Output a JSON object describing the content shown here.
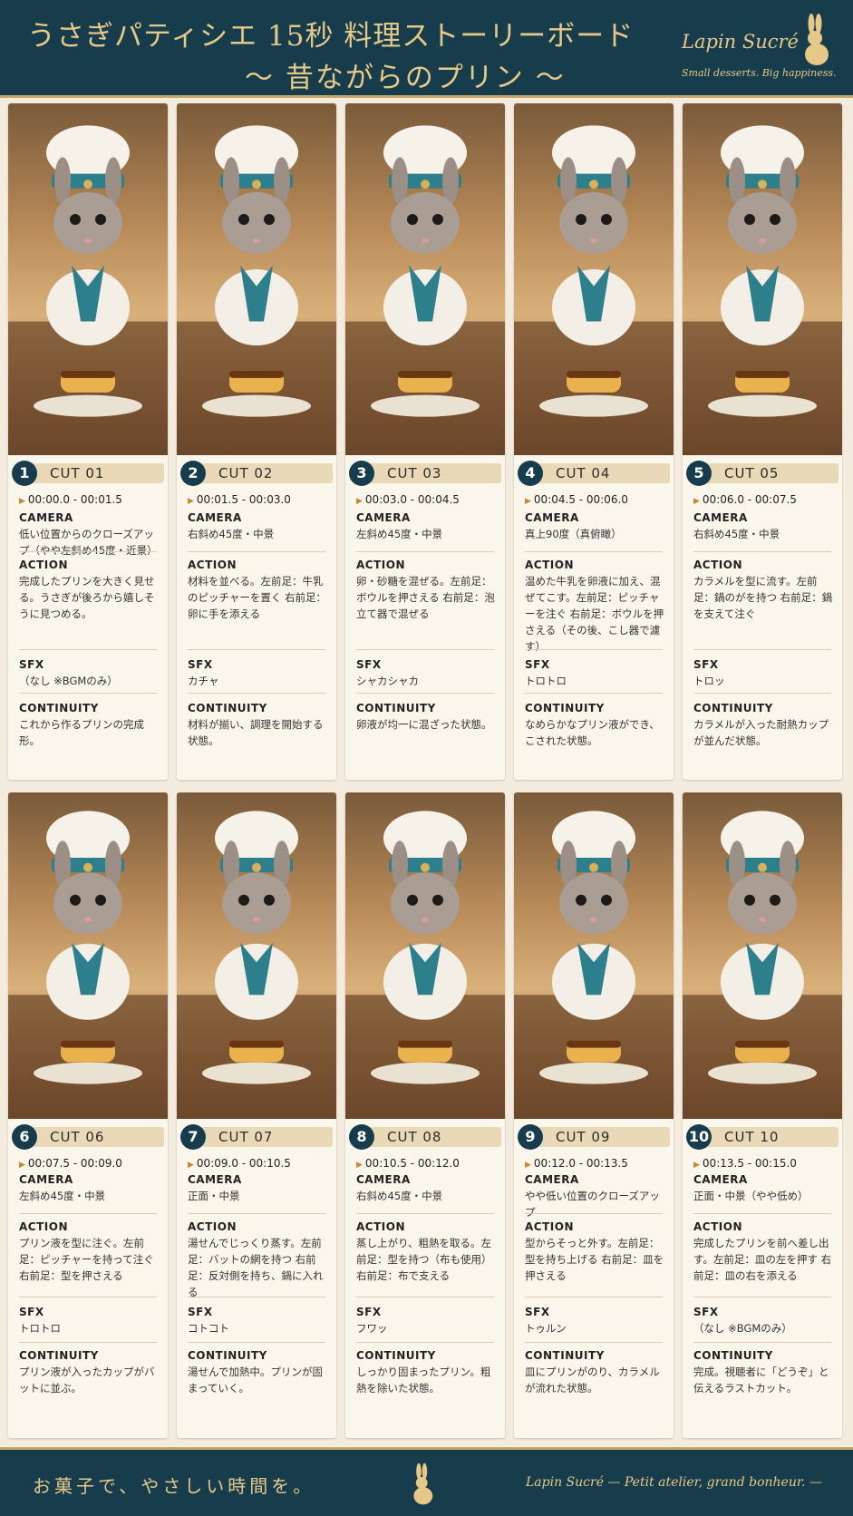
{
  "header": {
    "title_line1": "うさぎパティシエ 15秒 料理ストーリーボード",
    "title_line2": "〜 昔ながらのプリン 〜",
    "brand": "Lapin Sucré",
    "tagline": "Small desserts. Big happiness."
  },
  "labels": {
    "camera": "CAMERA",
    "action": "ACTION",
    "sfx": "SFX",
    "continuity": "CONTINUITY"
  },
  "cuts": [
    {
      "num": "1",
      "cut": "CUT 01",
      "time": "00:00.0 - 00:01.5",
      "camera": "低い位置からのクローズアップ（やや左斜め45度・近景）",
      "action": "完成したプリンを大きく見せる。うさぎが後ろから嬉しそうに見つめる。",
      "sfx": "（なし ※BGMのみ）",
      "continuity": "これから作るプリンの完成形。"
    },
    {
      "num": "2",
      "cut": "CUT 02",
      "time": "00:01.5 - 00:03.0",
      "camera": "右斜め45度・中景",
      "action": "材料を並べる。左前足：牛乳のピッチャーを置く 右前足：卵に手を添える",
      "sfx": "カチャ",
      "continuity": "材料が揃い、調理を開始する状態。"
    },
    {
      "num": "3",
      "cut": "CUT 03",
      "time": "00:03.0 - 00:04.5",
      "camera": "左斜め45度・中景",
      "action": "卵・砂糖を混ぜる。左前足：ボウルを押さえる 右前足：泡立て器で混ぜる",
      "sfx": "シャカシャカ",
      "continuity": "卵液が均一に混ざった状態。"
    },
    {
      "num": "4",
      "cut": "CUT 04",
      "time": "00:04.5 - 00:06.0",
      "camera": "真上90度（真俯瞰）",
      "action": "温めた牛乳を卵液に加え、混ぜてこす。左前足：ピッチャーを注ぐ 右前足：ボウルを押さえる（その後、こし器で濾す）",
      "sfx": "トロトロ",
      "continuity": "なめらかなプリン液ができ、こされた状態。"
    },
    {
      "num": "5",
      "cut": "CUT 05",
      "time": "00:06.0 - 00:07.5",
      "camera": "右斜め45度・中景",
      "action": "カラメルを型に流す。左前足：鍋のがを持つ 右前足：鍋を支えて注ぐ",
      "sfx": "トロッ",
      "continuity": "カラメルが入った耐熱カップが並んだ状態。"
    },
    {
      "num": "6",
      "cut": "CUT 06",
      "time": "00:07.5 - 00:09.0",
      "camera": "左斜め45度・中景",
      "action": "プリン液を型に注ぐ。左前足：ピッチャーを持って注ぐ 右前足：型を押さえる",
      "sfx": "トロトロ",
      "continuity": "プリン液が入ったカップがバットに並ぶ。"
    },
    {
      "num": "7",
      "cut": "CUT 07",
      "time": "00:09.0 - 00:10.5",
      "camera": "正面・中景",
      "action": "湯せんでじっくり蒸す。左前足：バットの網を持つ 右前足：反対側を持ち、鍋に入れる",
      "sfx": "コトコト",
      "continuity": "湯せんで加熱中。プリンが固まっていく。"
    },
    {
      "num": "8",
      "cut": "CUT 08",
      "time": "00:10.5 - 00:12.0",
      "camera": "右斜め45度・中景",
      "action": "蒸し上がり、粗熱を取る。左前足：型を持つ（布も使用） 右前足：布で支える",
      "sfx": "フワッ",
      "continuity": "しっかり固まったプリン。粗熱を除いた状態。"
    },
    {
      "num": "9",
      "cut": "CUT 09",
      "time": "00:12.0 - 00:13.5",
      "camera": "やや低い位置のクローズアップ",
      "action": "型からそっと外す。左前足：型を持ち上げる 右前足：皿を押さえる",
      "sfx": "トゥルン",
      "continuity": "皿にプリンがのり、カラメルが流れた状態。"
    },
    {
      "num": "10",
      "cut": "CUT 10",
      "time": "00:13.5 - 00:15.0",
      "camera": "正面・中景（やや低め）",
      "action": "完成したプリンを前へ差し出す。左前足：皿の左を押す 右前足：皿の右を添える",
      "sfx": "（なし ※BGMのみ）",
      "continuity": "完成。視聴者に「どうぞ」と伝えるラストカット。"
    }
  ],
  "footer": {
    "left": "お菓子で、やさしい時間を。",
    "right": "Lapin Sucré — Petit atelier, grand bonheur. —"
  },
  "colors": {
    "navy": "#173d4d",
    "gold": "#e6c888",
    "cream": "#fbf6ec",
    "accent": "#c8892e"
  },
  "icons": [
    "rabbit-logo-icon",
    "chef-rabbit-illustration",
    "play-triangle-icon"
  ]
}
